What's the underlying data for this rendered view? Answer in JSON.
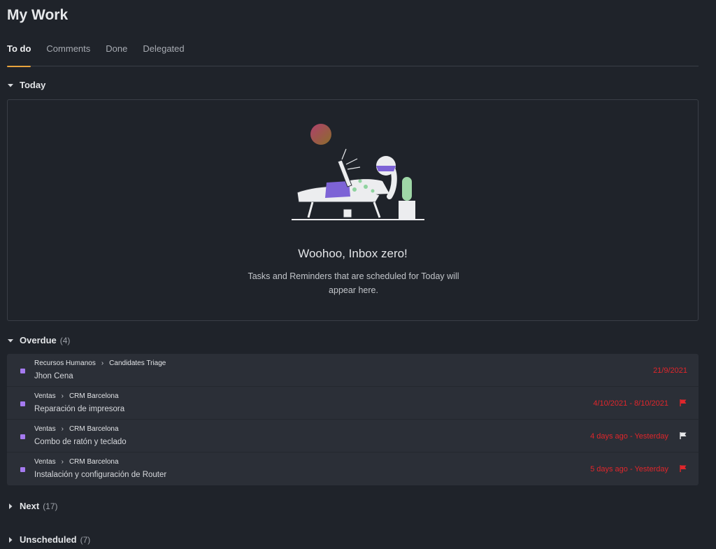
{
  "page": {
    "title": "My Work"
  },
  "tabs": [
    {
      "label": "To do",
      "active": true
    },
    {
      "label": "Comments",
      "active": false
    },
    {
      "label": "Done",
      "active": false
    },
    {
      "label": "Delegated",
      "active": false
    }
  ],
  "sections": {
    "today": {
      "label": "Today",
      "expanded": true
    },
    "overdue": {
      "label": "Overdue",
      "count": "(4)",
      "expanded": true
    },
    "next": {
      "label": "Next",
      "count": "(17)",
      "expanded": false
    },
    "unscheduled": {
      "label": "Unscheduled",
      "count": "(7)",
      "expanded": false
    }
  },
  "empty_state": {
    "title": "Woohoo, Inbox zero!",
    "description": "Tasks and Reminders that are scheduled for Today will appear here."
  },
  "overdue_tasks": [
    {
      "space": "Recursos Humanos",
      "list": "Candidates Triage",
      "name": "Jhon Cena",
      "date": "21/9/2021",
      "flag": "none"
    },
    {
      "space": "Ventas",
      "list": "CRM Barcelona",
      "name": "Reparación de impresora",
      "date": "4/10/2021 - 8/10/2021",
      "flag": "red"
    },
    {
      "space": "Ventas",
      "list": "CRM Barcelona",
      "name": "Combo de ratón y teclado",
      "date": "4 days ago - Yesterday",
      "flag": "white"
    },
    {
      "space": "Ventas",
      "list": "CRM Barcelona",
      "name": "Instalación y configuración de Router",
      "date": "5 days ago - Yesterday",
      "flag": "red"
    }
  ],
  "colors": {
    "accent": "#e8a33d",
    "overdue_date": "#e0262b",
    "task_status": "#a57af0",
    "background": "#1f232a",
    "row_background": "#2b2f37"
  },
  "icons": {
    "section_expanded": "caret-down-icon",
    "section_collapsed": "caret-right-icon",
    "breadcrumb_separator": "chevron-right-icon",
    "priority": "flag-icon"
  }
}
